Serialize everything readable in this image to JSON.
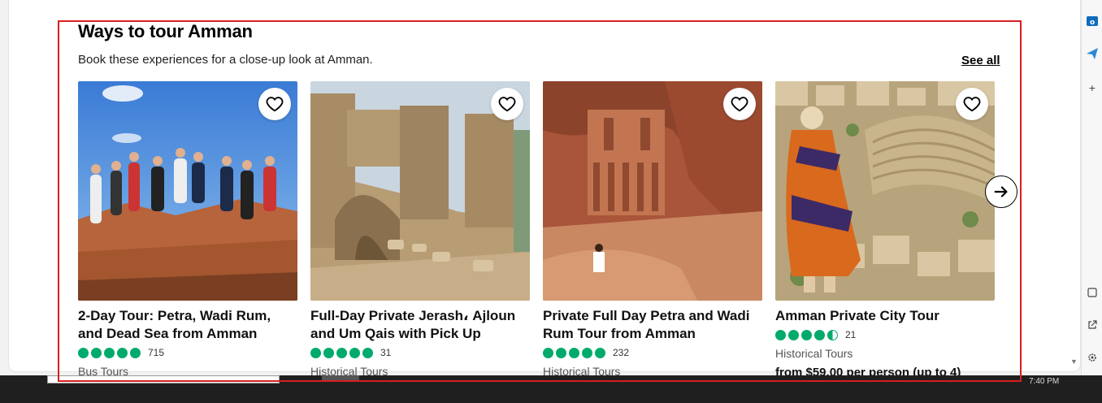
{
  "section": {
    "title": "Ways to tour Amman",
    "subtitle": "Book these experiences for a close-up look at Amman.",
    "see_all": "See all"
  },
  "cards": [
    {
      "title": "2-Day Tour: Petra, Wadi Rum, and Dead Sea from Amman",
      "rating": 5,
      "reviews": "715",
      "category": "Bus Tours",
      "image": "group-jumping-desert-photo"
    },
    {
      "title": "Full-Day Private Jerash، Ajloun and Um Qais with Pick Up",
      "rating": 5,
      "reviews": "31",
      "category": "Historical Tours",
      "image": "ancient-ruins-photo"
    },
    {
      "title": "Private Full Day Petra and Wadi Rum Tour from Amman",
      "rating": 5,
      "reviews": "232",
      "category": "Historical Tours",
      "image": "petra-treasury-photo"
    },
    {
      "title": "Amman Private City Tour",
      "rating": 4.5,
      "reviews": "21",
      "category": "Historical Tours",
      "price": "from $59.00 per person (up to 4)",
      "image": "amman-amphitheater-photo"
    }
  ],
  "icons": {
    "heart": "heart-icon",
    "next": "arrow-right-icon"
  },
  "colors": {
    "rating_green": "#00aa6c",
    "highlight_red": "#d61f1f"
  },
  "taskbar": {
    "clock": "7:40 PM"
  }
}
